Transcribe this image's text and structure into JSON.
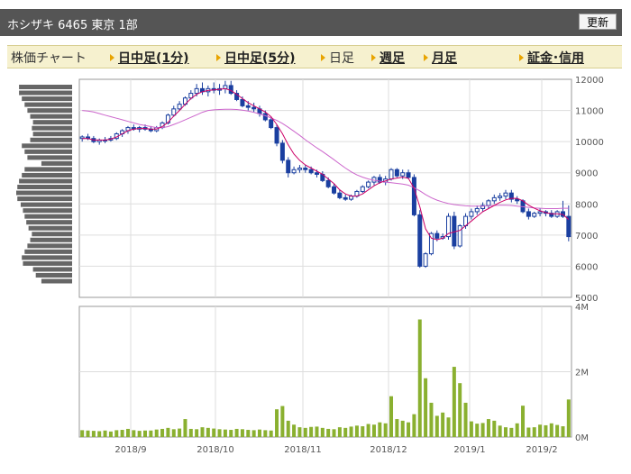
{
  "header": {
    "title": "ホシザキ  6465  東京 1部",
    "refresh_label": "更新"
  },
  "nav": {
    "label": "株価チャート",
    "items": [
      {
        "label": "日中足(1分)",
        "active": false
      },
      {
        "label": "日中足(5分)",
        "active": false
      },
      {
        "label": "日足",
        "active": true
      },
      {
        "label": "週足",
        "active": false
      },
      {
        "label": "月足",
        "active": false
      },
      {
        "label": "証金･信用",
        "active": false
      }
    ]
  },
  "colors": {
    "candle": "#1a3fa0",
    "ma_short": "#cc0066",
    "ma_long": "#cc66cc",
    "volume": "#8ab030",
    "profile": "#666666",
    "grid": "#dddddd"
  },
  "chart_data": [
    {
      "type": "candlestick",
      "y_ticks": [
        "5000",
        "6000",
        "7000",
        "8000",
        "9000",
        "10000",
        "11000",
        "12000"
      ],
      "ylim": [
        5000,
        12000
      ],
      "x_labels": [
        "2018/9",
        "2018/10",
        "2018/11",
        "2018/12",
        "2019/1",
        "2019/2"
      ],
      "ohlc": [
        [
          10100,
          10200,
          10000,
          10150
        ],
        [
          10150,
          10250,
          10050,
          10100
        ],
        [
          10100,
          10180,
          9950,
          10000
        ],
        [
          10000,
          10100,
          9900,
          10050
        ],
        [
          10050,
          10150,
          9950,
          10050
        ],
        [
          10050,
          10180,
          10000,
          10100
        ],
        [
          10100,
          10300,
          10050,
          10250
        ],
        [
          10250,
          10400,
          10150,
          10350
        ],
        [
          10350,
          10500,
          10250,
          10450
        ],
        [
          10450,
          10550,
          10350,
          10400
        ],
        [
          10400,
          10500,
          10300,
          10450
        ],
        [
          10450,
          10550,
          10350,
          10400
        ],
        [
          10400,
          10500,
          10300,
          10350
        ],
        [
          10350,
          10500,
          10300,
          10450
        ],
        [
          10450,
          10650,
          10400,
          10600
        ],
        [
          10600,
          10900,
          10550,
          10850
        ],
        [
          10850,
          11150,
          10800,
          11050
        ],
        [
          11050,
          11300,
          11000,
          11200
        ],
        [
          11200,
          11450,
          11150,
          11400
        ],
        [
          11400,
          11650,
          11350,
          11550
        ],
        [
          11550,
          11850,
          11450,
          11700
        ],
        [
          11700,
          11900,
          11500,
          11600
        ],
        [
          11600,
          11800,
          11450,
          11700
        ],
        [
          11700,
          11900,
          11550,
          11650
        ],
        [
          11650,
          11850,
          11500,
          11700
        ],
        [
          11700,
          11950,
          11550,
          11800
        ],
        [
          11800,
          11950,
          11500,
          11550
        ],
        [
          11550,
          11650,
          11300,
          11350
        ],
        [
          11350,
          11450,
          11100,
          11150
        ],
        [
          11150,
          11300,
          11000,
          11100
        ],
        [
          11100,
          11250,
          10950,
          11050
        ],
        [
          11050,
          11150,
          10800,
          10900
        ],
        [
          10900,
          11000,
          10650,
          10700
        ],
        [
          10700,
          10800,
          10400,
          10450
        ],
        [
          10450,
          10550,
          9850,
          9950
        ],
        [
          9950,
          10050,
          9300,
          9400
        ],
        [
          9400,
          9500,
          8850,
          9000
        ],
        [
          9000,
          9200,
          8950,
          9100
        ],
        [
          9100,
          9250,
          9000,
          9150
        ],
        [
          9150,
          9250,
          9000,
          9100
        ],
        [
          9100,
          9200,
          8950,
          9000
        ],
        [
          9000,
          9100,
          8850,
          8950
        ],
        [
          8950,
          9050,
          8700,
          8750
        ],
        [
          8750,
          8850,
          8500,
          8550
        ],
        [
          8550,
          8650,
          8300,
          8350
        ],
        [
          8350,
          8450,
          8150,
          8200
        ],
        [
          8200,
          8300,
          8100,
          8150
        ],
        [
          8150,
          8300,
          8100,
          8250
        ],
        [
          8250,
          8450,
          8200,
          8400
        ],
        [
          8400,
          8600,
          8350,
          8550
        ],
        [
          8550,
          8750,
          8500,
          8700
        ],
        [
          8700,
          8900,
          8600,
          8850
        ],
        [
          8850,
          8950,
          8650,
          8700
        ],
        [
          8700,
          8900,
          8600,
          8800
        ],
        [
          8800,
          9150,
          8750,
          9100
        ],
        [
          9100,
          9150,
          8850,
          8900
        ],
        [
          8900,
          9100,
          8800,
          9000
        ],
        [
          9000,
          9100,
          8800,
          8850
        ],
        [
          8850,
          8950,
          7600,
          7650
        ],
        [
          7650,
          7800,
          5950,
          6000
        ],
        [
          6000,
          6450,
          5950,
          6400
        ],
        [
          6400,
          7100,
          6350,
          7050
        ],
        [
          7050,
          7150,
          6800,
          6900
        ],
        [
          6900,
          7050,
          6850,
          6950
        ],
        [
          6950,
          7700,
          6850,
          7600
        ],
        [
          7600,
          7750,
          6550,
          6650
        ],
        [
          6650,
          7350,
          6600,
          7300
        ],
        [
          7300,
          7700,
          7200,
          7600
        ],
        [
          7600,
          7850,
          7500,
          7750
        ],
        [
          7750,
          7950,
          7650,
          7850
        ],
        [
          7850,
          8050,
          7750,
          7950
        ],
        [
          7950,
          8150,
          7850,
          8100
        ],
        [
          8100,
          8300,
          8000,
          8200
        ],
        [
          8200,
          8350,
          8100,
          8250
        ],
        [
          8250,
          8450,
          8150,
          8350
        ],
        [
          8350,
          8450,
          8050,
          8150
        ],
        [
          8150,
          8250,
          8000,
          8100
        ],
        [
          8100,
          8150,
          7700,
          7750
        ],
        [
          7750,
          7850,
          7500,
          7600
        ],
        [
          7600,
          7750,
          7550,
          7700
        ],
        [
          7700,
          7850,
          7600,
          7750
        ],
        [
          7750,
          7800,
          7600,
          7700
        ],
        [
          7700,
          7800,
          7550,
          7600
        ],
        [
          7600,
          7800,
          7550,
          7750
        ],
        [
          7750,
          8100,
          7550,
          7600
        ],
        [
          7600,
          7950,
          6800,
          6950
        ]
      ],
      "ma_short": [
        10100,
        10100,
        10050,
        10050,
        10050,
        10080,
        10150,
        10250,
        10350,
        10400,
        10420,
        10420,
        10400,
        10400,
        10480,
        10620,
        10820,
        11000,
        11200,
        11380,
        11520,
        11600,
        11640,
        11660,
        11680,
        11700,
        11640,
        11520,
        11380,
        11250,
        11150,
        11050,
        10950,
        10800,
        10550,
        10250,
        9900,
        9600,
        9400,
        9250,
        9150,
        9050,
        8950,
        8800,
        8650,
        8450,
        8320,
        8250,
        8250,
        8320,
        8450,
        8580,
        8680,
        8740,
        8800,
        8830,
        8860,
        8820,
        8500,
        7900,
        7200,
        6900,
        6850,
        6900,
        7050,
        7100,
        7150,
        7300,
        7450,
        7600,
        7750,
        7850,
        7950,
        8050,
        8130,
        8180,
        8180,
        8100,
        7960,
        7860,
        7780,
        7720,
        7680,
        7680,
        7660,
        7500
      ],
      "ma_long": [
        11000,
        10980,
        10950,
        10900,
        10850,
        10800,
        10750,
        10700,
        10650,
        10600,
        10550,
        10520,
        10480,
        10450,
        10450,
        10480,
        10550,
        10620,
        10700,
        10780,
        10860,
        10940,
        11000,
        11020,
        11030,
        11040,
        11040,
        11030,
        11010,
        10980,
        10940,
        10890,
        10830,
        10760,
        10680,
        10580,
        10460,
        10330,
        10200,
        10060,
        9930,
        9800,
        9680,
        9550,
        9420,
        9280,
        9150,
        9030,
        8930,
        8860,
        8800,
        8760,
        8730,
        8700,
        8680,
        8660,
        8640,
        8600,
        8520,
        8420,
        8300,
        8200,
        8120,
        8060,
        8010,
        7980,
        7960,
        7940,
        7930,
        7930,
        7930,
        7940,
        7950,
        7960,
        7960,
        7950,
        7930,
        7910,
        7890,
        7870,
        7860,
        7850,
        7850,
        7850,
        7860,
        7860
      ]
    },
    {
      "type": "bar",
      "y_ticks": [
        "0M",
        "2M",
        "4M"
      ],
      "ylim": [
        0,
        4000000
      ],
      "x_labels": [
        "2018/9",
        "2018/10",
        "2018/11",
        "2018/12",
        "2019/1",
        "2019/2"
      ],
      "values": [
        210000,
        200000,
        190000,
        180000,
        200000,
        170000,
        210000,
        220000,
        250000,
        210000,
        190000,
        200000,
        200000,
        230000,
        250000,
        280000,
        240000,
        260000,
        550000,
        250000,
        240000,
        300000,
        280000,
        260000,
        240000,
        230000,
        220000,
        250000,
        240000,
        220000,
        210000,
        230000,
        210000,
        200000,
        850000,
        950000,
        500000,
        380000,
        300000,
        280000,
        310000,
        320000,
        280000,
        250000,
        240000,
        300000,
        280000,
        320000,
        350000,
        330000,
        400000,
        380000,
        450000,
        420000,
        1250000,
        550000,
        500000,
        450000,
        700000,
        3600000,
        1800000,
        1050000,
        650000,
        750000,
        600000,
        2150000,
        1650000,
        1050000,
        480000,
        410000,
        430000,
        550000,
        500000,
        350000,
        300000,
        280000,
        420000,
        960000,
        290000,
        300000,
        380000,
        360000,
        420000,
        370000,
        330000,
        1150000
      ],
      "profile": [
        95,
        95,
        90,
        85,
        80,
        75,
        70,
        72,
        70,
        75,
        90,
        85,
        80,
        55,
        85,
        90,
        95,
        98,
        100,
        98,
        92,
        88,
        85,
        82,
        78,
        72,
        75,
        80,
        85,
        90,
        88,
        70,
        65,
        55
      ]
    }
  ]
}
